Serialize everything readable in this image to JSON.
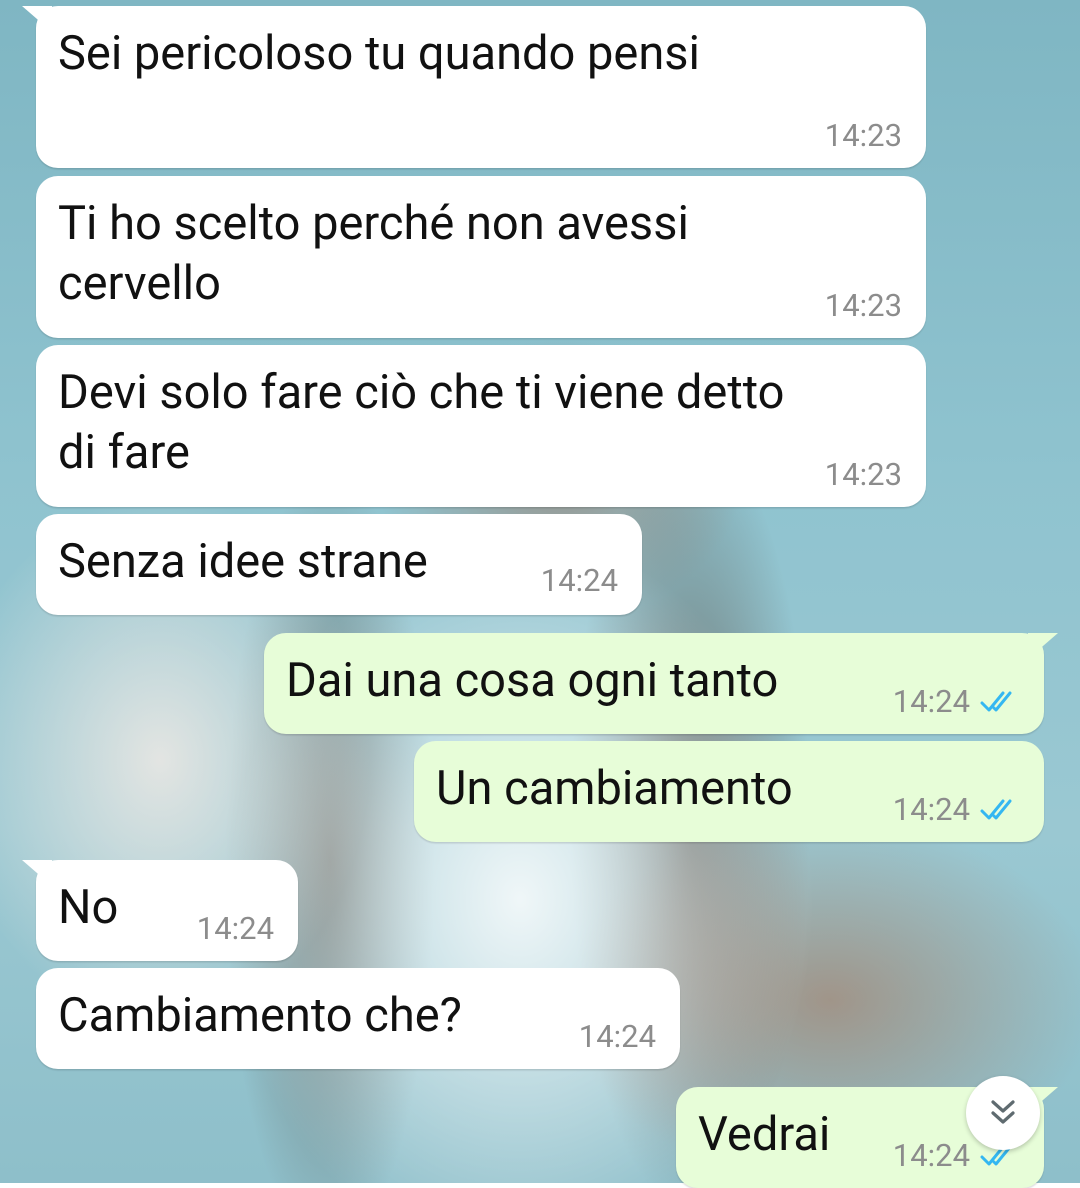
{
  "wallpaper": "photo-wallpaper",
  "colors": {
    "incoming_bubble": "#ffffff",
    "outgoing_bubble": "#e7fdd8",
    "timestamp": "#8c8c8c",
    "read_ticks": "#34b7f1"
  },
  "messages": [
    {
      "direction": "incoming",
      "text": "Sei pericoloso tu quando pensi",
      "time": "14:23"
    },
    {
      "direction": "incoming",
      "text": "Ti ho scelto perché non avessi\ncervello",
      "time": "14:23"
    },
    {
      "direction": "incoming",
      "text": "Devi solo fare ciò che ti viene detto\ndi fare",
      "time": "14:23"
    },
    {
      "direction": "incoming",
      "text": "Senza idee strane",
      "time": "14:24"
    },
    {
      "direction": "outgoing",
      "text": "Dai una cosa ogni tanto",
      "time": "14:24",
      "status": "read"
    },
    {
      "direction": "outgoing",
      "text": "Un cambiamento",
      "time": "14:24",
      "status": "read"
    },
    {
      "direction": "incoming",
      "text": "No",
      "time": "14:24"
    },
    {
      "direction": "incoming",
      "text": "Cambiamento che?",
      "time": "14:24"
    },
    {
      "direction": "outgoing",
      "text": "Vedrai",
      "time": "14:24",
      "status": "read"
    }
  ],
  "scroll_button": {
    "icon": "double-chevron-down-icon"
  }
}
